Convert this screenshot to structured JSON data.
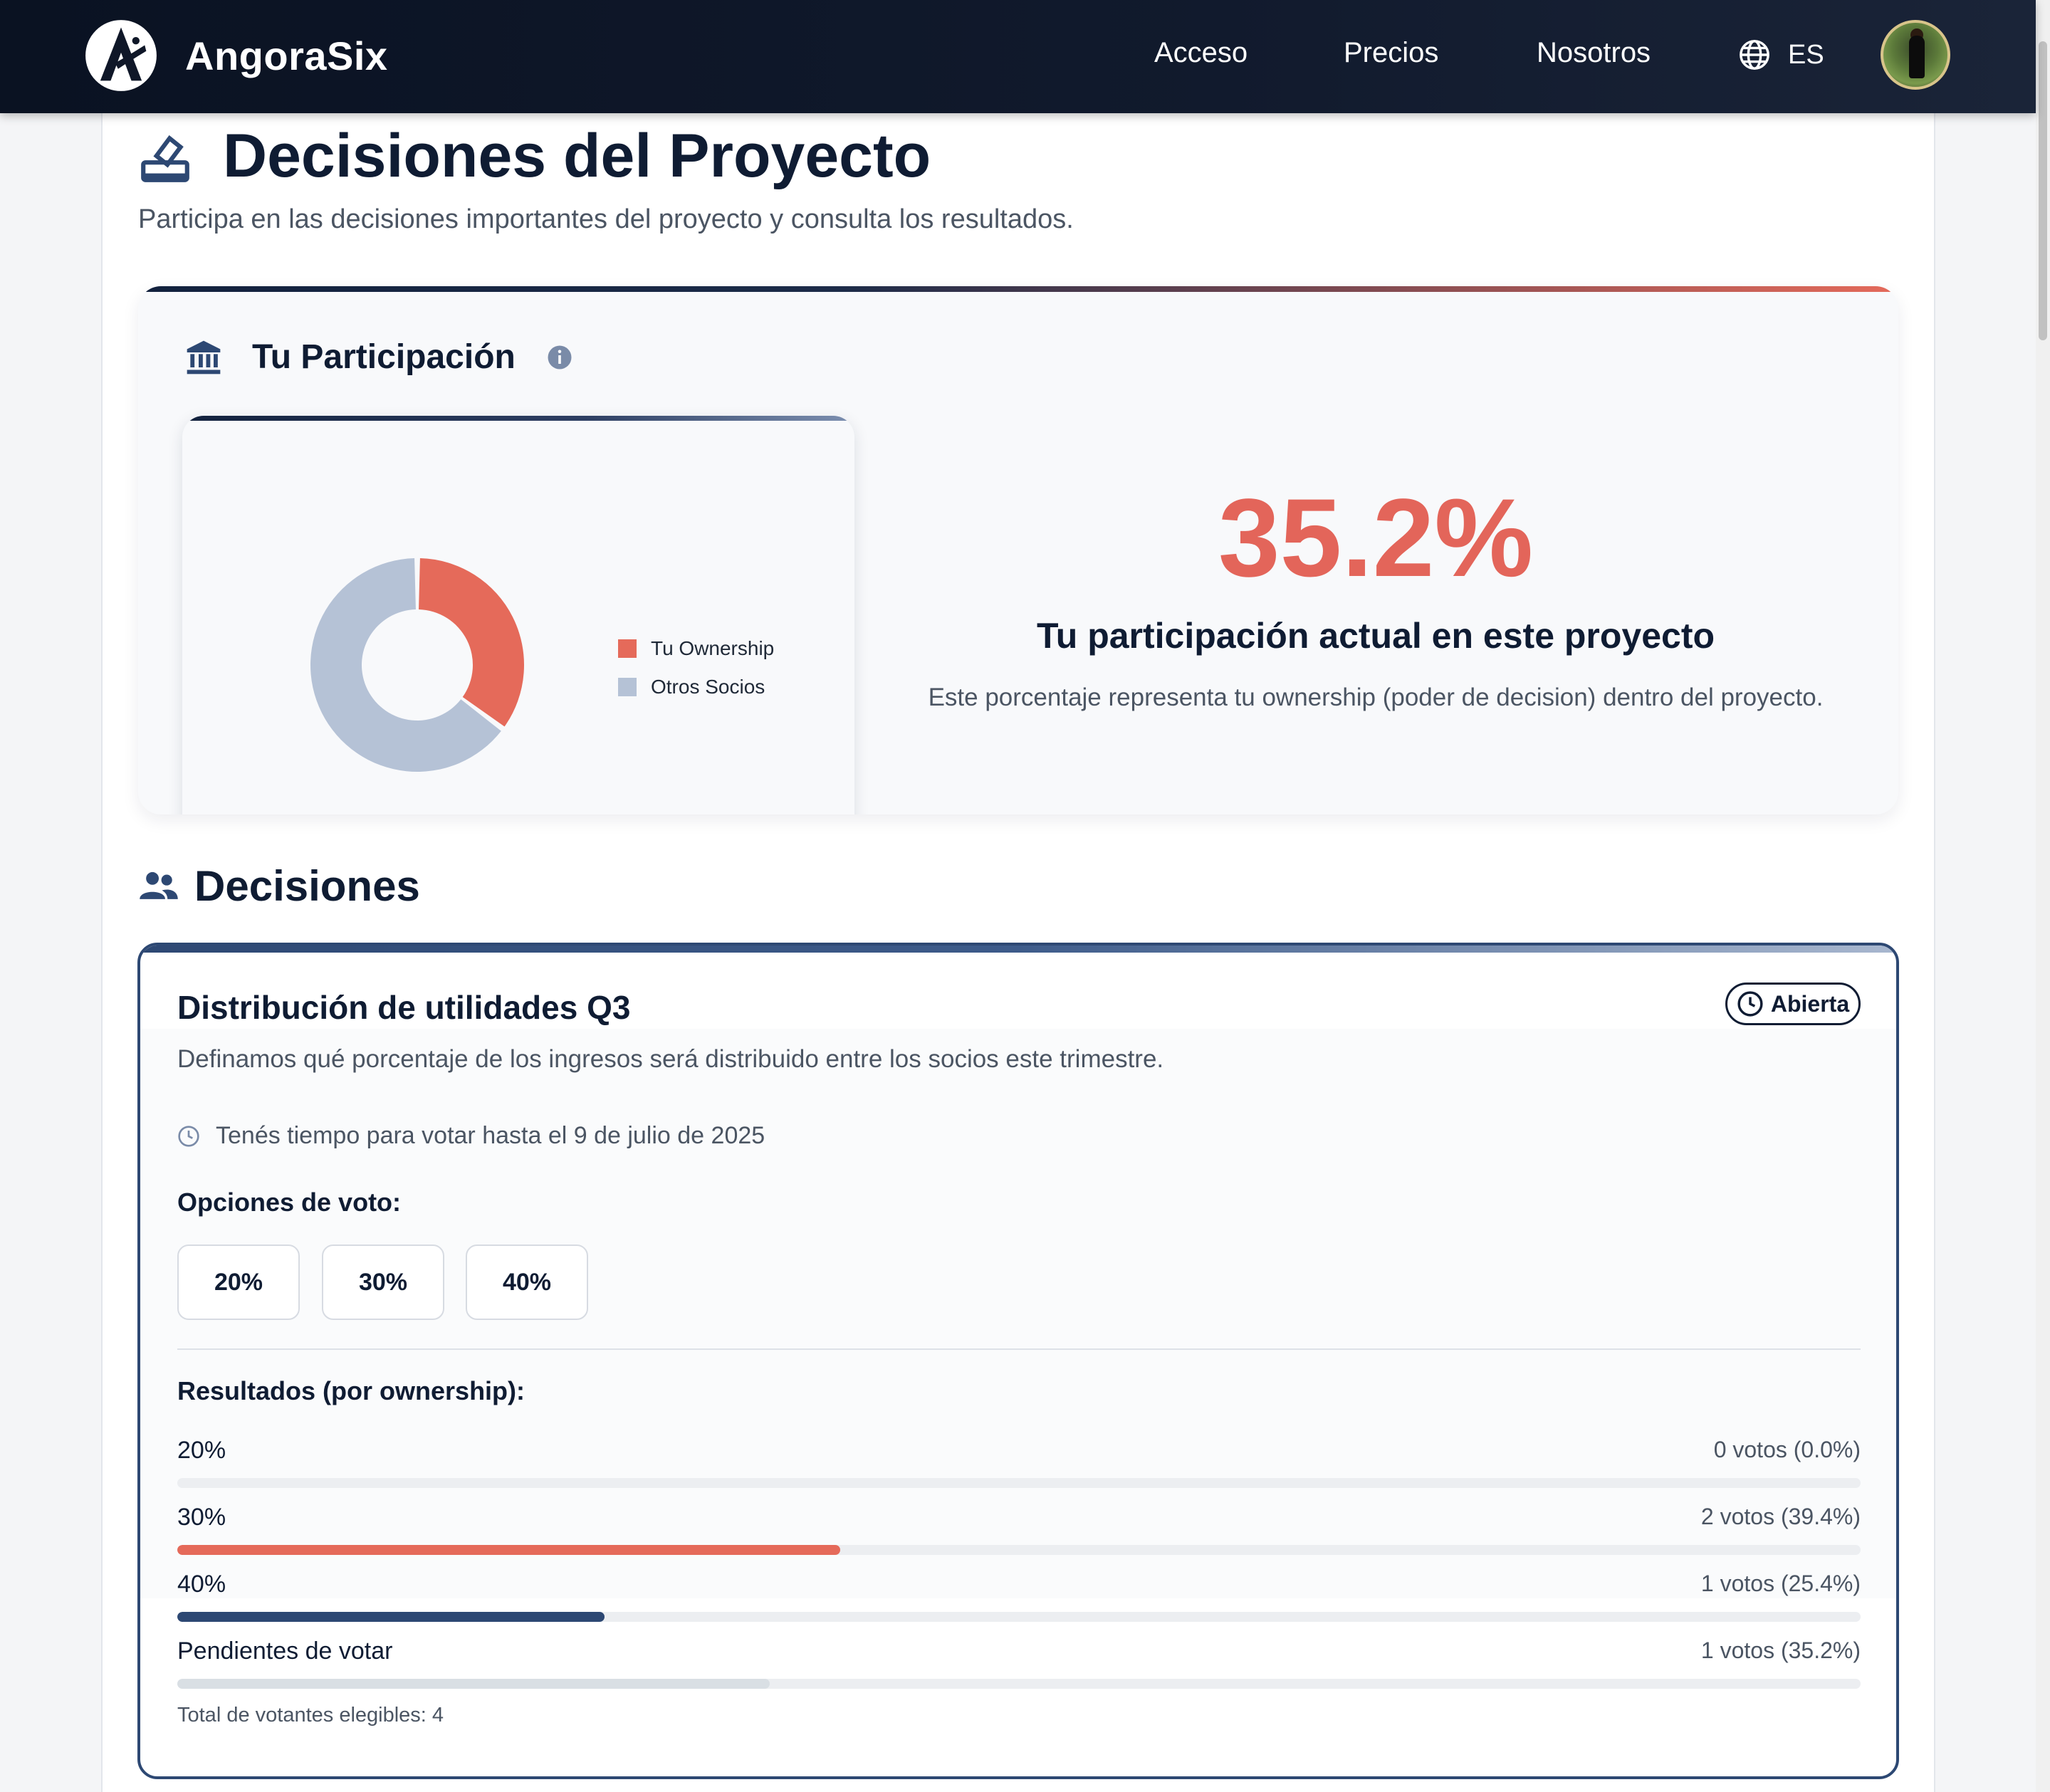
{
  "nav": {
    "brand": "AngoraSix",
    "links": [
      "Acceso",
      "Precios",
      "Nosotros"
    ],
    "language": "ES"
  },
  "page": {
    "title": "Decisiones del Proyecto",
    "subtitle": "Participa en las decisiones importantes del proyecto y consulta los resultados."
  },
  "participation": {
    "title": "Tu Participación",
    "percentage": "35.2%",
    "label": "Tu participación actual en este proyecto",
    "description": "Este porcentaje representa tu ownership (poder de decision) dentro del proyecto.",
    "legend": [
      "Tu Ownership",
      "Otros Socios"
    ]
  },
  "chart_data": {
    "type": "pie",
    "categories": [
      "Tu Ownership",
      "Otros Socios"
    ],
    "values": [
      35.2,
      64.8
    ],
    "colors": [
      "#e56a5a",
      "#b5c2d6"
    ],
    "legend_position": "right"
  },
  "decisions": {
    "section_title": "Decisiones",
    "items": [
      {
        "title": "Distribución de utilidades Q3",
        "status": "Abierta",
        "description": "Definamos qué porcentaje de los ingresos será distribuido entre los socios este trimestre.",
        "deadline": "Tenés tiempo para votar hasta el 9 de julio de 2025",
        "options_label": "Opciones de voto:",
        "options": [
          "20%",
          "30%",
          "40%"
        ],
        "results_label": "Resultados (por ownership):",
        "results": [
          {
            "name": "20%",
            "count": "0 votos (0.0%)",
            "share": 0.0,
            "color": "#e56a5a"
          },
          {
            "name": "30%",
            "count": "2 votos (39.4%)",
            "share": 39.4,
            "color": "#e56a5a"
          },
          {
            "name": "40%",
            "count": "1 votos (25.4%)",
            "share": 25.4,
            "color": "#2d4873"
          },
          {
            "name": "Pendientes de votar",
            "count": "1 votos (35.2%)",
            "share": 35.2,
            "color": "#d9dfe4"
          }
        ],
        "total": "Total de votantes elegibles: 4"
      }
    ]
  },
  "colors": {
    "accent": "#e56a5a",
    "navy": "#0f1c33",
    "blue": "#2d4873"
  }
}
